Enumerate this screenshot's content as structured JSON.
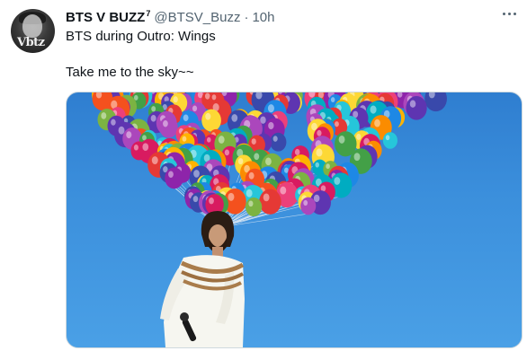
{
  "tweet": {
    "display_name": "BTS V BUZZ",
    "superscript": "7",
    "handle": "@BTSV_Buzz",
    "separator": "·",
    "time": "10h",
    "line1": "BTS during Outro: Wings",
    "line2": "Take me to the sky~~",
    "avatar_text": "Vbtz",
    "more_icon": "more-horizontal-icon"
  },
  "media": {
    "sky_color": "#3b8fdc",
    "balloon_colors": [
      "#e53935",
      "#fdd835",
      "#43a047",
      "#1e88e5",
      "#8e24aa",
      "#fb8c00",
      "#ec407a",
      "#26c6da",
      "#7cb342",
      "#3949ab",
      "#f4511e",
      "#ab47bc",
      "#00acc1",
      "#ffb300",
      "#5e35b1",
      "#d81b60"
    ]
  }
}
